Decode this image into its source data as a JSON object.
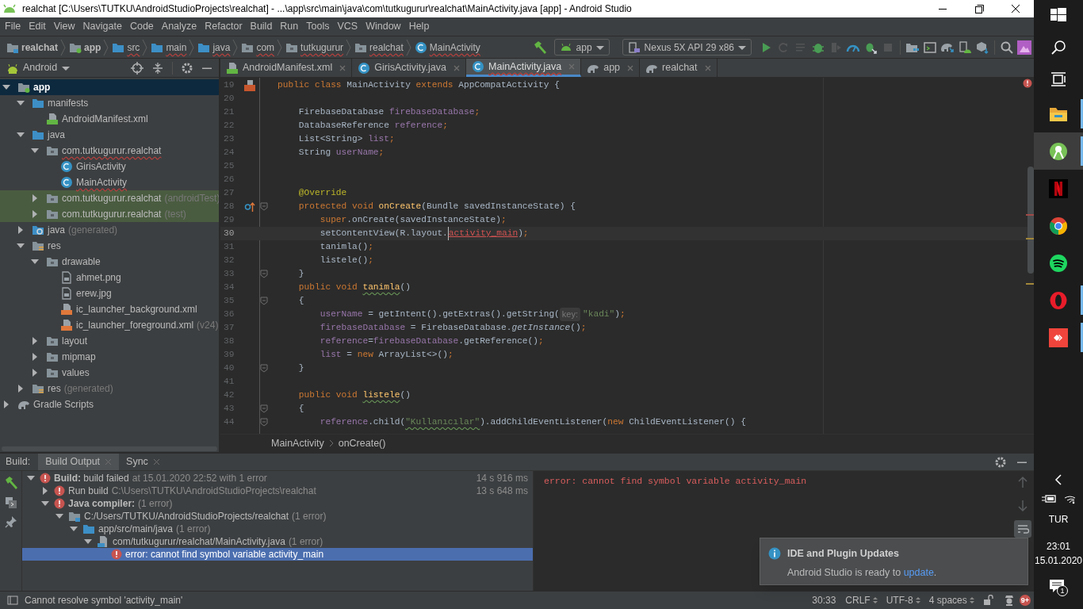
{
  "window": {
    "title": "realchat [C:\\Users\\TUTKU\\AndroidStudioProjects\\realchat] - ...\\app\\src\\main\\java\\com\\tutkugurur\\realchat\\MainActivity.java [app] - Android Studio"
  },
  "menu": [
    "File",
    "Edit",
    "View",
    "Navigate",
    "Code",
    "Analyze",
    "Refactor",
    "Build",
    "Run",
    "Tools",
    "VCS",
    "Window",
    "Help"
  ],
  "nav_path": [
    {
      "label": "realchat",
      "kind": "project",
      "bold": true,
      "problem": false
    },
    {
      "label": "app",
      "kind": "module",
      "bold": true,
      "problem": false
    },
    {
      "label": "src",
      "kind": "folder",
      "bold": false,
      "problem": true
    },
    {
      "label": "main",
      "kind": "folder",
      "bold": false,
      "problem": true
    },
    {
      "label": "java",
      "kind": "source",
      "bold": false,
      "problem": true
    },
    {
      "label": "com",
      "kind": "package",
      "bold": false,
      "problem": true
    },
    {
      "label": "tutkugurur",
      "kind": "package",
      "bold": false,
      "problem": true
    },
    {
      "label": "realchat",
      "kind": "package",
      "bold": false,
      "problem": true
    },
    {
      "label": "MainActivity",
      "kind": "class",
      "bold": false,
      "problem": true
    }
  ],
  "toolbar": {
    "run_config": "app",
    "device": "Nexus 5X API 29 x86",
    "actions": [
      {
        "kind": "run",
        "enabled": true
      },
      {
        "kind": "apply-restart",
        "enabled": false
      },
      {
        "kind": "apply-code",
        "enabled": false
      },
      {
        "kind": "debug",
        "enabled": true
      },
      {
        "kind": "attach",
        "enabled": false
      },
      {
        "kind": "profile",
        "enabled": true
      },
      {
        "kind": "debug-attach",
        "enabled": true
      },
      {
        "kind": "stop",
        "enabled": false
      },
      {
        "kind": "separator"
      },
      {
        "kind": "structure",
        "enabled": true
      },
      {
        "kind": "terminal",
        "enabled": true
      },
      {
        "kind": "sync",
        "enabled": true
      },
      {
        "kind": "avd",
        "enabled": true
      },
      {
        "kind": "sdk",
        "enabled": true
      },
      {
        "kind": "separator"
      },
      {
        "kind": "search",
        "enabled": true
      },
      {
        "kind": "plugin",
        "enabled": true
      }
    ]
  },
  "project": {
    "view": "Android",
    "tree": [
      {
        "label": "app",
        "kind": "module",
        "expanded": true,
        "selected": true,
        "highlighted": false,
        "problem": false,
        "children": [
          {
            "label": "manifests",
            "kind": "folder",
            "expanded": true,
            "selected": false,
            "highlighted": false,
            "problem": false,
            "children": [
              {
                "label": "AndroidManifest.xml",
                "kind": "manifest",
                "selected": false,
                "highlighted": false,
                "problem": false
              }
            ]
          },
          {
            "label": "java",
            "kind": "folder",
            "expanded": true,
            "selected": false,
            "highlighted": false,
            "problem": false,
            "children": [
              {
                "label": "com.tutkugurur.realchat",
                "kind": "package",
                "expanded": true,
                "selected": false,
                "highlighted": false,
                "problem": true,
                "children": [
                  {
                    "label": "GirisActivity",
                    "kind": "class",
                    "selected": false,
                    "highlighted": false,
                    "problem": false
                  },
                  {
                    "label": "MainActivity",
                    "kind": "class",
                    "selected": false,
                    "highlighted": false,
                    "problem": true
                  }
                ]
              },
              {
                "label": "com.tutkugurur.realchat",
                "suffix": "(androidTest)",
                "kind": "package",
                "expanded": false,
                "selected": false,
                "highlighted": true,
                "problem": false
              },
              {
                "label": "com.tutkugurur.realchat",
                "suffix": "(test)",
                "kind": "package",
                "expanded": false,
                "selected": false,
                "highlighted": true,
                "problem": false
              }
            ]
          },
          {
            "label": "java",
            "suffix": "(generated)",
            "kind": "generated",
            "expanded": false,
            "selected": false,
            "highlighted": false,
            "problem": false
          },
          {
            "label": "res",
            "kind": "res",
            "expanded": true,
            "selected": false,
            "highlighted": false,
            "problem": false,
            "children": [
              {
                "label": "drawable",
                "kind": "package",
                "expanded": true,
                "selected": false,
                "highlighted": false,
                "problem": false,
                "children": [
                  {
                    "label": "ahmet.png",
                    "kind": "image",
                    "selected": false,
                    "highlighted": false,
                    "problem": false
                  },
                  {
                    "label": "erew.jpg",
                    "kind": "image",
                    "selected": false,
                    "highlighted": false,
                    "problem": false
                  },
                  {
                    "label": "ic_launcher_background.xml",
                    "kind": "xml",
                    "selected": false,
                    "highlighted": false,
                    "problem": false
                  },
                  {
                    "label": "ic_launcher_foreground.xml",
                    "suffix": "(v24)",
                    "kind": "xml",
                    "selected": false,
                    "highlighted": false,
                    "problem": false
                  }
                ]
              },
              {
                "label": "layout",
                "kind": "package",
                "expanded": false,
                "selected": false,
                "highlighted": false,
                "problem": false
              },
              {
                "label": "mipmap",
                "kind": "package",
                "expanded": false,
                "selected": false,
                "highlighted": false,
                "problem": false
              },
              {
                "label": "values",
                "kind": "package",
                "expanded": false,
                "selected": false,
                "highlighted": false,
                "problem": false
              }
            ]
          },
          {
            "label": "res",
            "suffix": "(generated)",
            "kind": "res",
            "expanded": false,
            "selected": false,
            "highlighted": false,
            "problem": false
          }
        ]
      },
      {
        "label": "Gradle Scripts",
        "kind": "gradle",
        "expanded": false,
        "selected": false,
        "highlighted": false,
        "problem": false
      }
    ]
  },
  "editor": {
    "tabs": [
      {
        "label": "AndroidManifest.xml",
        "kind": "manifest",
        "selected": false,
        "problem": false
      },
      {
        "label": "GirisActivity.java",
        "kind": "class",
        "selected": false,
        "problem": false
      },
      {
        "label": "MainActivity.java",
        "kind": "class",
        "selected": true,
        "problem": true
      },
      {
        "label": "app",
        "kind": "gradle",
        "selected": false,
        "problem": false
      },
      {
        "label": "realchat",
        "kind": "gradle",
        "selected": false,
        "problem": false
      }
    ],
    "lines": [
      {
        "number": "19",
        "gutter": {
          "kind": "class"
        },
        "fold": false,
        "current": false,
        "code": [
          {
            "kind": "kw",
            "text": "public class "
          },
          {
            "kind": "plain",
            "text": "MainActivity "
          },
          {
            "kind": "kw",
            "text": "extends "
          },
          {
            "kind": "plain",
            "text": "AppCompatActivity {"
          }
        ]
      },
      {
        "number": "20",
        "fold": false,
        "current": false
      },
      {
        "number": "21",
        "fold": false,
        "current": false,
        "code": [
          {
            "kind": "plain",
            "text": "    FirebaseDatabase "
          },
          {
            "kind": "field",
            "text": "firebaseDatabase"
          },
          {
            "kind": "kw",
            "text": ";"
          }
        ]
      },
      {
        "number": "22",
        "fold": false,
        "current": false,
        "code": [
          {
            "kind": "plain",
            "text": "    DatabaseReference "
          },
          {
            "kind": "field",
            "text": "reference"
          },
          {
            "kind": "kw",
            "text": ";"
          }
        ]
      },
      {
        "number": "23",
        "fold": false,
        "current": false,
        "code": [
          {
            "kind": "plain",
            "text": "    List<String> "
          },
          {
            "kind": "field",
            "text": "list"
          },
          {
            "kind": "kw",
            "text": ";"
          }
        ]
      },
      {
        "number": "24",
        "fold": false,
        "current": false,
        "code": [
          {
            "kind": "plain",
            "text": "    String "
          },
          {
            "kind": "field",
            "text": "userName"
          },
          {
            "kind": "kw",
            "text": ";"
          }
        ]
      },
      {
        "number": "25",
        "fold": false,
        "current": false
      },
      {
        "number": "26",
        "fold": false,
        "current": false
      },
      {
        "number": "27",
        "fold": false,
        "current": false,
        "code": [
          {
            "kind": "ann",
            "text": "    @Override"
          }
        ]
      },
      {
        "number": "28",
        "gutter": {
          "kind": "override"
        },
        "fold": true,
        "current": false,
        "code": [
          {
            "kind": "kw",
            "text": "    protected void "
          },
          {
            "kind": "decl",
            "text": "onCreate"
          },
          {
            "kind": "plain",
            "text": "(Bundle savedInstanceState) {"
          }
        ]
      },
      {
        "number": "29",
        "fold": false,
        "current": false,
        "code": [
          {
            "kind": "kw",
            "text": "        super"
          },
          {
            "kind": "plain",
            "text": ".onCreate(savedInstanceState)"
          },
          {
            "kind": "kw",
            "text": ";"
          }
        ]
      },
      {
        "number": "30",
        "fold": false,
        "current": true,
        "code": [
          {
            "kind": "plain",
            "text": "        setContentView(R.layout."
          },
          {
            "kind": "err",
            "text": "activity_main"
          },
          {
            "kind": "plain",
            "text": ")"
          },
          {
            "kind": "kw",
            "text": ";"
          }
        ]
      },
      {
        "number": "31",
        "fold": false,
        "current": false,
        "code": [
          {
            "kind": "plain",
            "text": "        tanimla()"
          },
          {
            "kind": "kw",
            "text": ";"
          }
        ]
      },
      {
        "number": "32",
        "fold": false,
        "current": false,
        "code": [
          {
            "kind": "plain",
            "text": "        listele()"
          },
          {
            "kind": "kw",
            "text": ";"
          }
        ]
      },
      {
        "number": "33",
        "fold": true,
        "current": false,
        "code": [
          {
            "kind": "plain",
            "text": "    }"
          }
        ]
      },
      {
        "number": "34",
        "fold": false,
        "current": false,
        "code": [
          {
            "kind": "kw",
            "text": "    public void "
          },
          {
            "kind": "decl-typo",
            "text": "tanimla"
          },
          {
            "kind": "plain",
            "text": "()"
          }
        ]
      },
      {
        "number": "35",
        "fold": true,
        "current": false,
        "code": [
          {
            "kind": "plain",
            "text": "    {"
          }
        ]
      },
      {
        "number": "36",
        "fold": false,
        "current": false,
        "code": [
          {
            "kind": "field",
            "text": "        userName"
          },
          {
            "kind": "plain",
            "text": " = getIntent().getExtras().getString("
          },
          {
            "kind": "hint",
            "text": "key:"
          },
          {
            "kind": "str",
            "text": "\"kadi\""
          },
          {
            "kind": "plain",
            "text": ")"
          },
          {
            "kind": "kw",
            "text": ";"
          }
        ]
      },
      {
        "number": "37",
        "fold": false,
        "current": false,
        "code": [
          {
            "kind": "field",
            "text": "        firebaseDatabase"
          },
          {
            "kind": "plain",
            "text": " = FirebaseDatabase."
          },
          {
            "kind": "static",
            "text": "getInstance"
          },
          {
            "kind": "plain",
            "text": "()"
          },
          {
            "kind": "kw",
            "text": ";"
          }
        ]
      },
      {
        "number": "38",
        "fold": false,
        "current": false,
        "code": [
          {
            "kind": "field",
            "text": "        reference"
          },
          {
            "kind": "plain",
            "text": "="
          },
          {
            "kind": "field",
            "text": "firebaseDatabase"
          },
          {
            "kind": "plain",
            "text": ".getReference()"
          },
          {
            "kind": "kw",
            "text": ";"
          }
        ]
      },
      {
        "number": "39",
        "fold": false,
        "current": false,
        "code": [
          {
            "kind": "field",
            "text": "        list"
          },
          {
            "kind": "plain",
            "text": " = "
          },
          {
            "kind": "kw",
            "text": "new "
          },
          {
            "kind": "plain",
            "text": "ArrayList<>()"
          },
          {
            "kind": "kw",
            "text": ";"
          }
        ]
      },
      {
        "number": "40",
        "fold": true,
        "current": false,
        "code": [
          {
            "kind": "plain",
            "text": "    }"
          }
        ]
      },
      {
        "number": "41",
        "fold": false,
        "current": false
      },
      {
        "number": "42",
        "fold": false,
        "current": false,
        "code": [
          {
            "kind": "kw",
            "text": "    public void "
          },
          {
            "kind": "decl-typo",
            "text": "listele"
          },
          {
            "kind": "plain",
            "text": "()"
          }
        ]
      },
      {
        "number": "43",
        "fold": true,
        "current": false,
        "code": [
          {
            "kind": "plain",
            "text": "    {"
          }
        ]
      },
      {
        "number": "44",
        "fold": true,
        "current": false,
        "code": [
          {
            "kind": "field",
            "text": "        reference"
          },
          {
            "kind": "plain",
            "text": ".child("
          },
          {
            "kind": "str-typo",
            "text": "\"Kullanıcılar\""
          },
          {
            "kind": "plain",
            "text": ").addChildEventListener("
          },
          {
            "kind": "kw",
            "text": "new "
          },
          {
            "kind": "plain",
            "text": "ChildEventListener() {"
          }
        ]
      }
    ],
    "breadcrumb": [
      "MainActivity",
      "onCreate()"
    ]
  },
  "build": {
    "label": "Build:",
    "tabs": [
      {
        "label": "Build Output",
        "selected": true
      },
      {
        "label": "Sync",
        "selected": false
      }
    ],
    "tree": [
      {
        "label": "**Build:** build failed",
        "detail": "at 15.01.2020 22:52  with 1 error",
        "time": "14 s 916 ms",
        "kind": "error",
        "bold": false,
        "expanded": true,
        "selected": false,
        "children": [
          {
            "label": "Run build",
            "detail": "C:\\Users\\TUTKU\\AndroidStudioProjects\\realchat",
            "time": "13 s 648 ms",
            "kind": "error",
            "bold": false,
            "expanded": false,
            "selected": false
          },
          {
            "label": "Java compiler:",
            "detail": "(1 error)",
            "kind": "error",
            "bold": true,
            "expanded": true,
            "selected": false,
            "children": [
              {
                "label": "C:/Users/TUTKU/AndroidStudioProjects/realchat",
                "detail": "(1 error)",
                "kind": "project",
                "bold": false,
                "expanded": true,
                "selected": false,
                "children": [
                  {
                    "label": "app/src/main/java",
                    "detail": "(1 error)",
                    "kind": "folder",
                    "bold": false,
                    "expanded": true,
                    "selected": false,
                    "children": [
                      {
                        "label": "com/tutkugurur/realchat/MainActivity.java",
                        "detail": "(1 error)",
                        "kind": "file",
                        "bold": false,
                        "expanded": true,
                        "selected": false,
                        "children": [
                          {
                            "label": "error: cannot find symbol variable activity_main",
                            "kind": "error",
                            "bold": false,
                            "selected": true
                          }
                        ]
                      }
                    ]
                  }
                ]
              }
            ]
          }
        ]
      }
    ],
    "output": "error: cannot find symbol variable activity_main"
  },
  "notification": {
    "title": "IDE and Plugin Updates",
    "message": "Android Studio is ready to ",
    "link": "update",
    "message_end": "."
  },
  "status": {
    "message": "Cannot resolve symbol 'activity_main'",
    "position": "30:33",
    "line_separator": "CRLF",
    "encoding": "UTF-8",
    "indent": "4 spaces",
    "notifications": "9+"
  },
  "taskbar": {
    "apps": [
      {
        "kind": "windows",
        "running": false,
        "selected": false
      },
      {
        "kind": "search",
        "running": false,
        "selected": false
      },
      {
        "kind": "task-view",
        "running": false,
        "selected": false
      },
      {
        "kind": "explorer",
        "running": true,
        "selected": false
      },
      {
        "kind": "android-studio",
        "running": true,
        "selected": true
      },
      {
        "kind": "ribbon",
        "running": false,
        "selected": false
      },
      {
        "kind": "chrome",
        "running": false,
        "selected": false
      },
      {
        "kind": "spotify",
        "running": false,
        "selected": false
      },
      {
        "kind": "opera",
        "running": true,
        "selected": false
      },
      {
        "kind": "desk",
        "running": true,
        "selected": false
      }
    ],
    "language": "TUR",
    "time": "23:01",
    "date": "15.01.2020",
    "action_center_count": "1"
  }
}
